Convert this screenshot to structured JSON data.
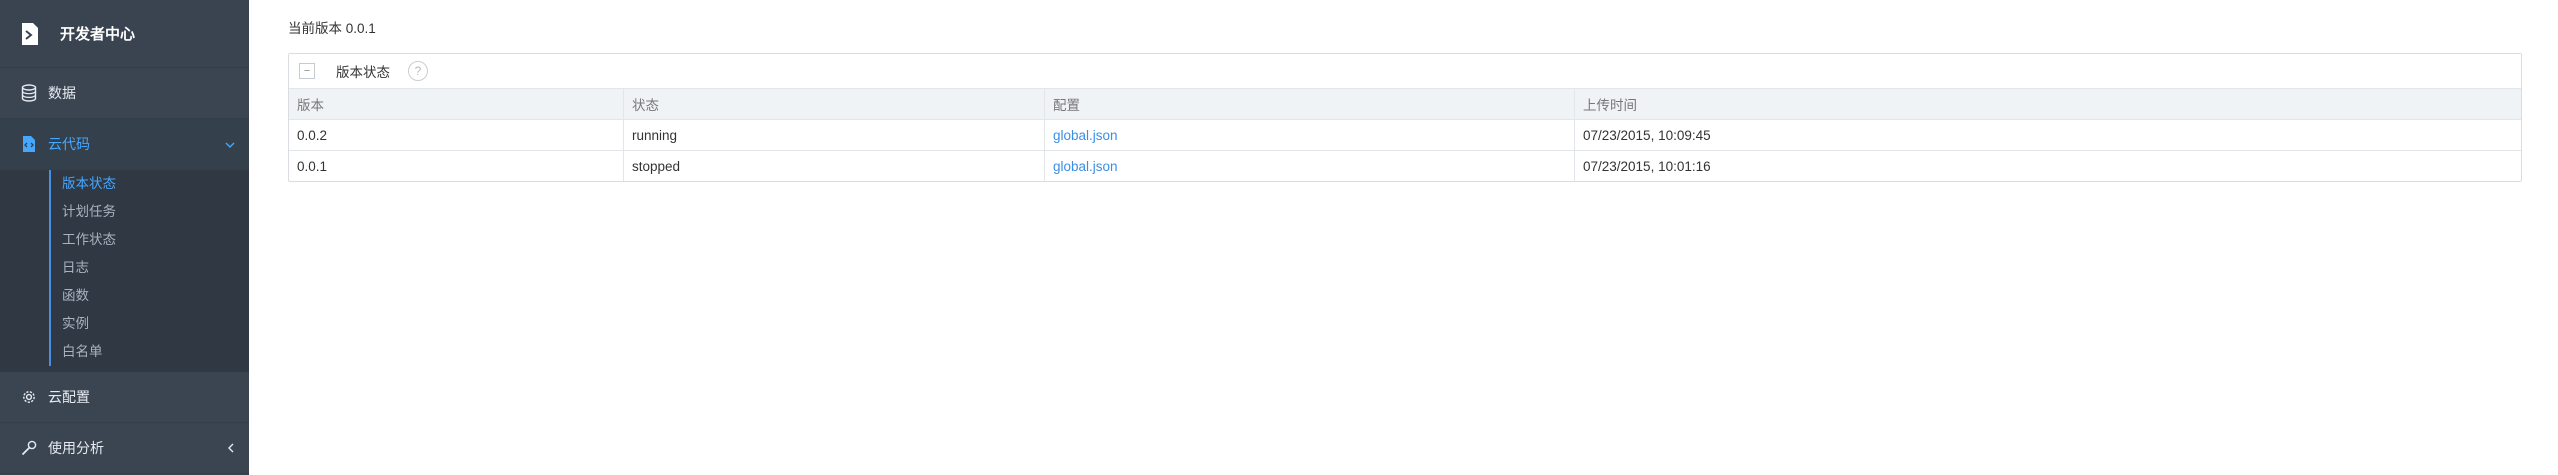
{
  "brand": {
    "title": "开发者中心",
    "icon": "terminal-doc-icon"
  },
  "sidebar": {
    "items": [
      {
        "label": "数据",
        "icon": "database-icon"
      },
      {
        "label": "云代码",
        "icon": "code-file-icon",
        "expanded": true
      },
      {
        "label": "云配置",
        "icon": "gear-icon"
      },
      {
        "label": "使用分析",
        "icon": "wrench-icon"
      }
    ],
    "subitems": [
      "版本状态",
      "计划任务",
      "工作状态",
      "日志",
      "函数",
      "实例",
      "白名单"
    ],
    "active_subitem": "版本状态"
  },
  "main": {
    "current_version": "当前版本 0.0.1",
    "panel": {
      "title": "版本状态",
      "toggle_symbol": "−",
      "help_symbol": "?",
      "columns": [
        "版本",
        "状态",
        "配置",
        "上传时间"
      ],
      "rows": [
        {
          "version": "0.0.2",
          "status": "running",
          "config": "global.json",
          "uploaded": "07/23/2015, 10:09:45"
        },
        {
          "version": "0.0.1",
          "status": "stopped",
          "config": "global.json",
          "uploaded": "07/23/2015, 10:01:16"
        }
      ]
    }
  },
  "colors": {
    "sidebar_bg": "#3b4552",
    "accent": "#46a7ff",
    "link": "#3a8ee6"
  }
}
